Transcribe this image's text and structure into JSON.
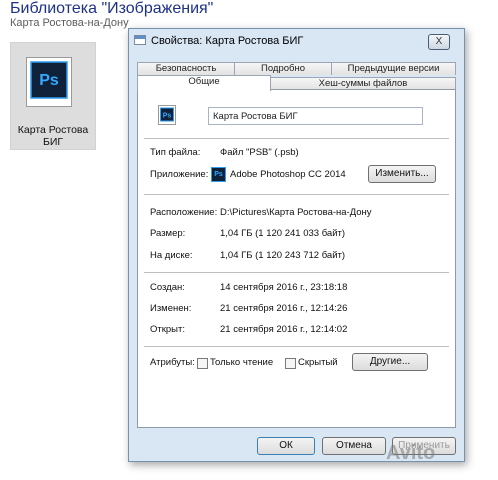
{
  "library": {
    "title": "Библиотека \"Изображения\"",
    "subtitle": "Карта Ростова-на-Дону",
    "file_tile": {
      "label_line1": "Карта Ростова",
      "label_line2": "БИГ",
      "icon_text": "Ps"
    }
  },
  "dialog": {
    "title": "Свойства: Карта Ростова БИГ",
    "close_label": "X",
    "tabs_back": [
      "Безопасность",
      "Подробно",
      "Предыдущие версии"
    ],
    "tabs_front": [
      "Общие",
      "Хеш-суммы файлов"
    ],
    "active_tab": "Общие",
    "general": {
      "file_icon_text": "Ps",
      "file_name": "Карта Ростова БИГ",
      "file_type_label": "Тип файла:",
      "file_type_value": "Файл \"PSB\" (.psb)",
      "app_label": "Приложение:",
      "app_icon_text": "Ps",
      "app_value": "Adobe Photoshop CC 2014",
      "change_button": "Изменить...",
      "location_label": "Расположение:",
      "location_value": "D:\\Pictures\\Карта Ростова-на-Дону",
      "size_label": "Размер:",
      "size_value": "1,04 ГБ (1 120 241 033 байт)",
      "disk_label": "На диске:",
      "disk_value": "1,04 ГБ (1 120 243 712 байт)",
      "created_label": "Создан:",
      "created_value": "14 сентября 2016 г., 23:18:18",
      "modified_label": "Изменен:",
      "modified_value": "21 сентября 2016 г., 12:14:26",
      "opened_label": "Открыт:",
      "opened_value": "21 сентября 2016 г., 12:14:02",
      "attributes_label": "Атрибуты:",
      "readonly_label": "Только чтение",
      "readonly_checked": false,
      "hidden_label": "Скрытый",
      "hidden_checked": false,
      "other_button": "Другие..."
    },
    "buttons": {
      "ok": "ОК",
      "cancel": "Отмена",
      "apply": "Применить"
    }
  },
  "watermark": "Avito",
  "colors": {
    "ps_dark": "#10213a",
    "ps_blue": "#33a9ff",
    "frame": "#d9e6f4",
    "title_blue": "#1e3287"
  }
}
